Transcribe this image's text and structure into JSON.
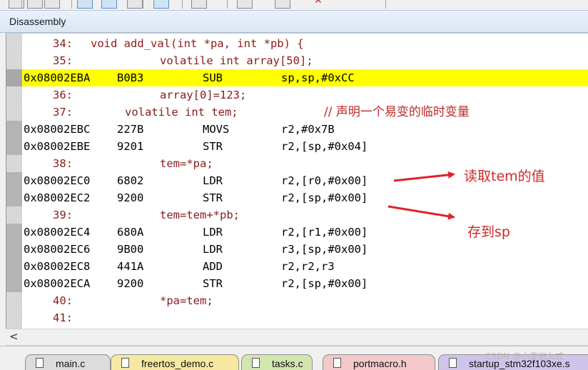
{
  "window": {
    "title": "Disassembly"
  },
  "toolbar": {
    "icons": [
      "unknown-icon",
      "unknown-icon",
      "unknown-icon",
      "unknown-icon",
      "unknown-icon",
      "unknown-icon",
      "unknown-icon",
      "unknown-icon",
      "unknown-icon",
      "unknown-icon",
      "close-icon"
    ]
  },
  "listing": [
    {
      "kind": "src",
      "line": "34:",
      "code": "void add_val(int *pa, int *pb) {"
    },
    {
      "kind": "src",
      "line": "35:",
      "code": "volatile int array[50];"
    },
    {
      "kind": "asm",
      "address": "0x08002EBA",
      "opcode": "B0B3",
      "mnemonic": "SUB",
      "operands": "sp,sp,#0xCC",
      "highlight": true
    },
    {
      "kind": "src",
      "line": "36:",
      "code": "array[0]=123;"
    },
    {
      "kind": "src",
      "line": "37:",
      "code": "volatile int tem;",
      "comment": "// 声明一个易变的临时变量"
    },
    {
      "kind": "asm",
      "address": "0x08002EBC",
      "opcode": "227B",
      "mnemonic": "MOVS",
      "operands": "r2,#0x7B"
    },
    {
      "kind": "asm",
      "address": "0x08002EBE",
      "opcode": "9201",
      "mnemonic": "STR",
      "operands": "r2,[sp,#0x04]"
    },
    {
      "kind": "src",
      "line": "38:",
      "code": "tem=*pa;"
    },
    {
      "kind": "asm",
      "address": "0x08002EC0",
      "opcode": "6802",
      "mnemonic": "LDR",
      "operands": "r2,[r0,#0x00]"
    },
    {
      "kind": "asm",
      "address": "0x08002EC2",
      "opcode": "9200",
      "mnemonic": "STR",
      "operands": "r2,[sp,#0x00]"
    },
    {
      "kind": "src",
      "line": "39:",
      "code": "tem=tem+*pb;"
    },
    {
      "kind": "asm",
      "address": "0x08002EC4",
      "opcode": "680A",
      "mnemonic": "LDR",
      "operands": "r2,[r1,#0x00]"
    },
    {
      "kind": "asm",
      "address": "0x08002EC6",
      "opcode": "9B00",
      "mnemonic": "LDR",
      "operands": "r3,[sp,#0x00]"
    },
    {
      "kind": "asm",
      "address": "0x08002EC8",
      "opcode": "441A",
      "mnemonic": "ADD",
      "operands": "r2,r2,r3"
    },
    {
      "kind": "asm",
      "address": "0x08002ECA",
      "opcode": "9200",
      "mnemonic": "STR",
      "operands": "r2,[sp,#0x00]"
    },
    {
      "kind": "src",
      "line": "40:",
      "code": "*pa=tem;"
    },
    {
      "kind": "src",
      "line": "41:",
      "code": ""
    }
  ],
  "annotations": {
    "read_tem": "读取tem的值",
    "store_sp": "存到sp",
    "arrow_color": "#e0222a"
  },
  "scrollbar": {
    "left_arrow": "<"
  },
  "tabs": [
    {
      "label": "main.c",
      "color": "#dcdcdc",
      "icon": "file-icon"
    },
    {
      "label": "freertos_demo.c",
      "color": "#f6e8a0",
      "icon": "file-icon"
    },
    {
      "label": "tasks.c",
      "color": "#d4e6b0",
      "icon": "file-icon"
    },
    {
      "label": "portmacro.h",
      "color": "#f3c9cc",
      "icon": "file-icon"
    },
    {
      "label": "startup_stm32f103xe.s",
      "color": "#cfc5ea",
      "icon": "file-icon"
    }
  ],
  "watermark": "CSDN @小麦嵌入式",
  "colors": {
    "highlight": "#ffff00",
    "source_text": "#8b1a1a",
    "comment": "#c0282a"
  }
}
